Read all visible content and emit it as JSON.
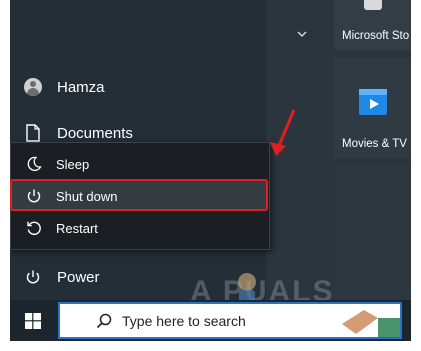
{
  "start_menu": {
    "user_name": "Hamza",
    "documents_label": "Documents",
    "power_label": "Power"
  },
  "power_menu": {
    "items": [
      {
        "label": "Sleep"
      },
      {
        "label": "Shut down"
      },
      {
        "label": "Restart"
      }
    ]
  },
  "tiles": {
    "store_label": "Microsoft Sto",
    "movies_label": "Movies & TV"
  },
  "taskbar": {
    "search_placeholder": "Type here to search"
  },
  "watermark": {
    "text": "A  PUALS"
  },
  "colors": {
    "highlight": "#e02020",
    "search_border": "#2b72c9",
    "movies_icon": "#1f8ae5"
  }
}
